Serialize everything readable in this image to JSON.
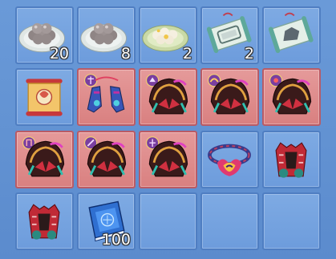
{
  "inventory": {
    "slots": [
      {
        "icon": "gray-dumplings-plate-icon",
        "quantity": "20",
        "border": "blue"
      },
      {
        "icon": "gray-dumplings-plate-icon",
        "quantity": "8",
        "border": "blue"
      },
      {
        "icon": "rice-balls-plate-icon",
        "quantity": "2",
        "border": "blue"
      },
      {
        "icon": "scroll-blueprint-icon",
        "quantity": "2",
        "border": "blue"
      },
      {
        "icon": "scroll-blueprint-icon",
        "quantity": "",
        "border": "blue"
      },
      {
        "icon": "red-banner-scroll-icon",
        "quantity": "",
        "border": "blue"
      },
      {
        "icon": "blue-armor-boots-icon",
        "quantity": "",
        "border": "red"
      },
      {
        "icon": "dragon-helmet-icon",
        "quantity": "",
        "border": "red"
      },
      {
        "icon": "dragon-helmet-icon",
        "quantity": "",
        "border": "red"
      },
      {
        "icon": "dragon-helmet-icon",
        "quantity": "",
        "border": "red"
      },
      {
        "icon": "dragon-helmet-icon",
        "quantity": "",
        "border": "red"
      },
      {
        "icon": "dragon-helmet-icon",
        "quantity": "",
        "border": "red"
      },
      {
        "icon": "dragon-helmet-icon",
        "quantity": "",
        "border": "red"
      },
      {
        "icon": "flame-crown-icon",
        "quantity": "",
        "border": "blue"
      },
      {
        "icon": "red-armor-vest-icon",
        "quantity": "",
        "border": "blue"
      },
      {
        "icon": "red-armor-vest-icon",
        "quantity": "",
        "border": "blue"
      },
      {
        "icon": "blue-book-icon",
        "quantity": "100",
        "border": "blue"
      },
      {
        "icon": "",
        "quantity": "",
        "border": "blue"
      },
      {
        "icon": "",
        "quantity": "",
        "border": "blue"
      },
      {
        "icon": "",
        "quantity": "",
        "border": "blue"
      }
    ]
  }
}
